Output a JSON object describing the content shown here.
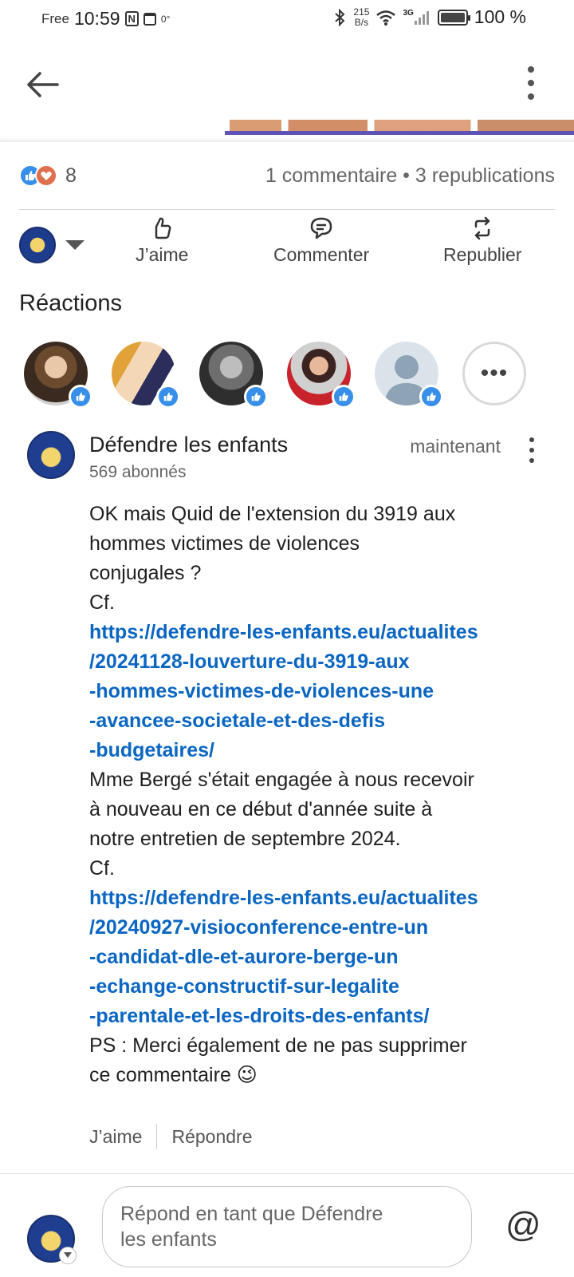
{
  "status_bar": {
    "carrier": "Free",
    "time": "10:59",
    "nfc": "N",
    "degree": "0°",
    "speed_value": "215",
    "speed_unit": "B/s",
    "network": "3G",
    "battery_percent": "100 %"
  },
  "post": {
    "reaction_count": "8",
    "comments_reposts": "1 commentaire • 3 republications"
  },
  "actions": {
    "like": "J’aime",
    "comment": "Commenter",
    "repost": "Republier"
  },
  "reactions": {
    "title": "Réactions",
    "more": "•••"
  },
  "comment": {
    "author": "Défendre les enfants",
    "time": "maintenant",
    "followers": "569 abonnés",
    "body": {
      "p1_l1": "OK mais Quid de l'extension du 3919 aux",
      "p1_l2": "hommes victimes de violences",
      "p1_l3": "conjugales ?",
      "cf1": "Cf.",
      "link1_l1": "https://defendre-les-enfants.eu/actualites",
      "link1_l2": "/20241128-louverture-du-3919-aux",
      "link1_l3": "-hommes-victimes-de-violences-une",
      "link1_l4": "-avancee-societale-et-des-defis",
      "link1_l5": "-budgetaires/",
      "p2_l1": "Mme Bergé s'était engagée à nous recevoir",
      "p2_l2": "à nouveau en ce début d'année suite à",
      "p2_l3": "notre entretien de septembre 2024.",
      "cf2": "Cf.",
      "link2_l1": "https://defendre-les-enfants.eu/actualites",
      "link2_l2": "/20240927-visioconference-entre-un",
      "link2_l3": "-candidat-dle-et-aurore-berge-un",
      "link2_l4": "-echange-constructif-sur-legalite",
      "link2_l5": "-parentale-et-les-droits-des-enfants/",
      "ps_l1": "PS : Merci également de ne pas supprimer",
      "ps_l2": "ce commentaire 😉"
    },
    "like": "J’aime",
    "reply": "Répondre"
  },
  "reply_bar": {
    "placeholder_l1": "Répond en tant que Défendre",
    "placeholder_l2": "les enfants",
    "mention": "@"
  },
  "colors": {
    "link": "#0a66c2",
    "like_blue": "#378fe9",
    "love_orange": "#df704d"
  }
}
